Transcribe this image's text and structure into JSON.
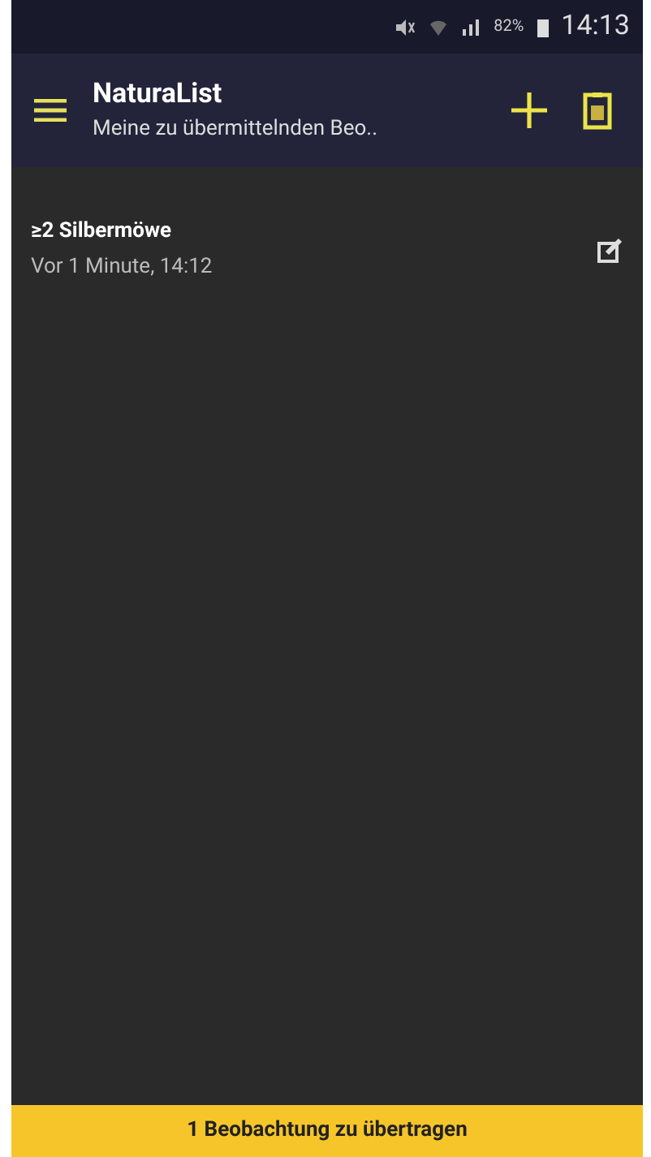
{
  "status_bar": {
    "battery": "82%",
    "time": "14:13"
  },
  "app_bar": {
    "title": "NaturaList",
    "subtitle": "Meine zu übermittelnden Beo.."
  },
  "observations": [
    {
      "title": "≥2 Silbermöwe",
      "time": "Vor 1 Minute, 14:12"
    }
  ],
  "footer": {
    "label": "1 Beobachtung zu übertragen"
  }
}
